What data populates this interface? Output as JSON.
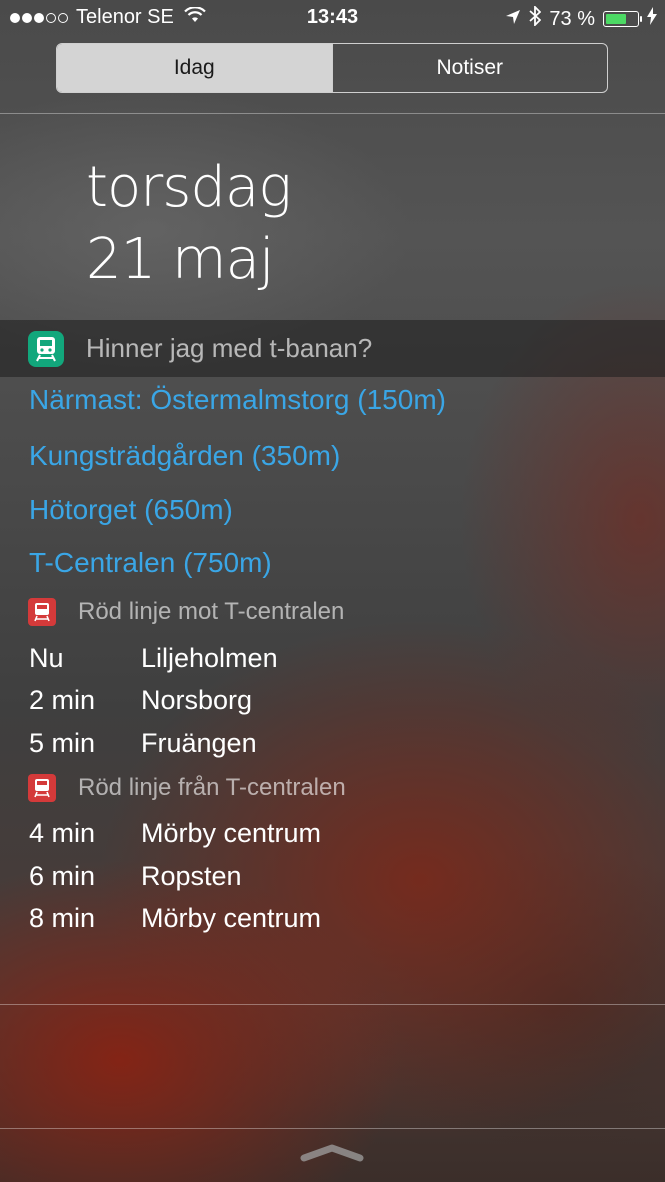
{
  "status_bar": {
    "carrier": "Telenor SE",
    "time": "13:43",
    "battery_percent": "73 %",
    "battery_level": 0.73,
    "signal_bars_filled": 3,
    "signal_bars_total": 5
  },
  "segmented": {
    "today": "Idag",
    "notifications": "Notiser",
    "selected": "Idag"
  },
  "date": {
    "weekday": "torsdag",
    "day_month": "21 maj"
  },
  "widget": {
    "title": "Hinner jag med t-banan?",
    "icon": "train-icon",
    "accent_color": "#12a77c",
    "stations": [
      "Närmast: Östermalmstorg (150m)",
      "Kungsträdgården (350m)",
      "Hötorget (650m)",
      "T-Centralen (750m)"
    ],
    "lines": [
      {
        "label": "Röd linje mot T-centralen",
        "color": "#d43a3a",
        "departures": [
          {
            "when": "Nu",
            "destination": "Liljeholmen"
          },
          {
            "when": "2 min",
            "destination": "Norsborg"
          },
          {
            "when": "5 min",
            "destination": "Fruängen"
          }
        ]
      },
      {
        "label": "Röd linje från T-centralen",
        "color": "#d43a3a",
        "departures": [
          {
            "when": "4 min",
            "destination": "Mörby centrum"
          },
          {
            "when": "6 min",
            "destination": "Ropsten"
          },
          {
            "when": "8 min",
            "destination": "Mörby centrum"
          }
        ]
      }
    ]
  },
  "link_color": "#3aa6e6"
}
